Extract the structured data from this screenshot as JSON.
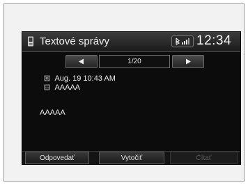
{
  "header": {
    "title": "Textové správy",
    "title_icon": "phone-icon",
    "status_icons": [
      "bluetooth-icon",
      "signal-strength-icon"
    ],
    "clock": "12:34"
  },
  "navigation": {
    "prev_icon": "arrow-left-icon",
    "next_icon": "arrow-right-icon",
    "page_indicator": "1/20"
  },
  "message": {
    "date_icon": "clock-icon",
    "date": "Aug. 19 10:43 AM",
    "sender_icon": "contact-icon",
    "sender": "AAAAA",
    "body": "AAAAA"
  },
  "actions": {
    "reply_label": "Odpovedať",
    "call_label": "Vytočiť",
    "read_label": "Čítať",
    "read_enabled": false
  },
  "colors": {
    "screen_background": "#0c0c0c",
    "text": "#ececec",
    "disabled_text": "#5a5a5a"
  }
}
